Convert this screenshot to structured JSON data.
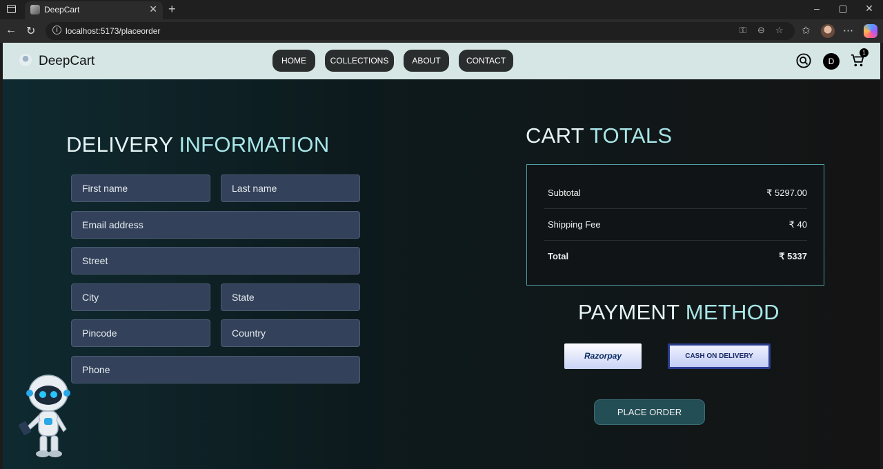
{
  "browser": {
    "tab_title": "DeepCart",
    "url": "localhost:5173/placeorder"
  },
  "navbar": {
    "brand": "DeepCart",
    "links": [
      "HOME",
      "COLLECTIONS",
      "ABOUT",
      "CONTACT"
    ],
    "user_initial": "D",
    "cart_count": "1"
  },
  "delivery": {
    "heading_part1": "DELIVERY",
    "heading_part2": "INFORMATION",
    "fields": {
      "first_name": "First name",
      "last_name": "Last name",
      "email": "Email address",
      "street": "Street",
      "city": "City",
      "state": "State",
      "pincode": "Pincode",
      "country": "Country",
      "phone": "Phone"
    }
  },
  "cart_totals": {
    "heading_part1": "CART",
    "heading_part2": "TOTALS",
    "subtotal_label": "Subtotal",
    "subtotal_value": "₹ 5297.00",
    "shipping_label": "Shipping Fee",
    "shipping_value": "₹ 40",
    "total_label": "Total",
    "total_value": "₹ 5337"
  },
  "payment": {
    "heading_part1": "PAYMENT",
    "heading_part2": "METHOD",
    "razorpay_label": "Razorpay",
    "cod_label": "CASH ON DELIVERY",
    "selected": "CASH ON DELIVERY",
    "place_order_label": "PLACE ORDER"
  },
  "colors": {
    "accent_teal": "#a8e6e8",
    "navbar_bg": "#d5e6e5",
    "field_bg": "#33425a",
    "place_order_bg": "#234e56"
  }
}
